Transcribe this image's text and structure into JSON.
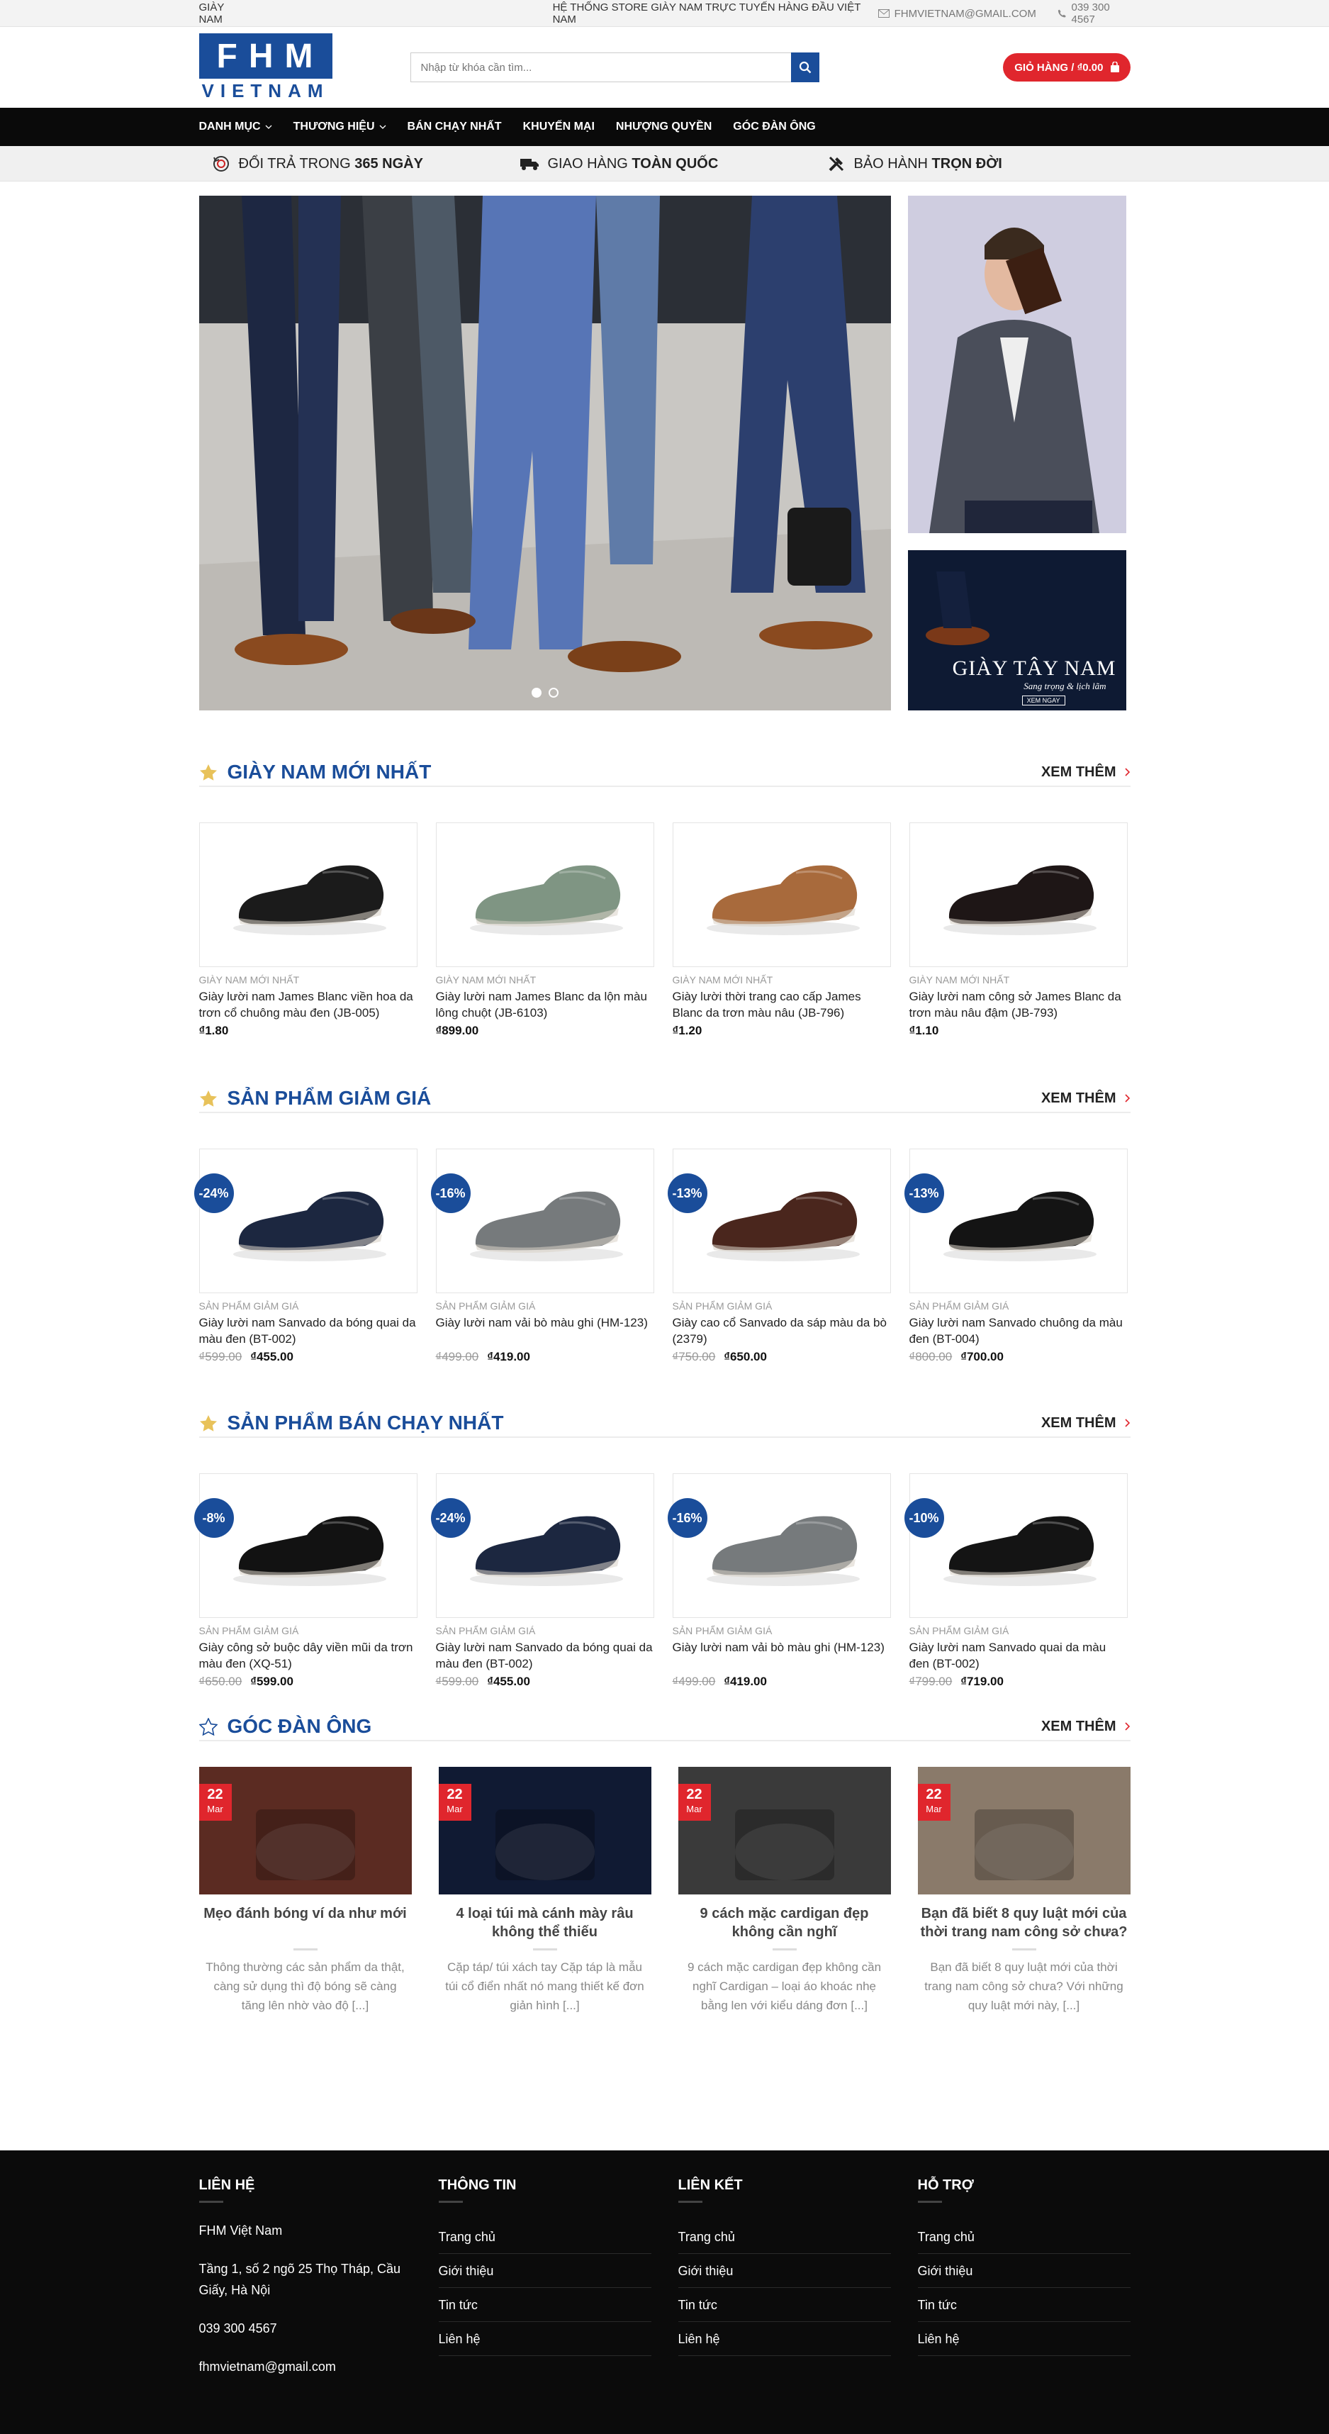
{
  "topbar": {
    "left": "GIÀY NAM",
    "slogan": "HỆ THỐNG STORE GIÀY NAM TRỰC TUYẾN HÀNG ĐẦU VIỆT NAM",
    "email": "FHMVIETNAM@GMAIL.COM",
    "phone": "039 300 4567"
  },
  "header": {
    "logo_letters": [
      "F",
      "H",
      "M"
    ],
    "logo_sub": "VIETNAM",
    "search_placeholder": "Nhập từ khóa cần tìm...",
    "cart": "GIỎ HÀNG / ₫0.00"
  },
  "nav": [
    "DANH MỤC",
    "THƯƠNG HIỆU",
    "BÁN CHẠY NHẤT",
    "KHUYẾN MẠI",
    "NHƯỢNG QUYỀN",
    "GÓC ĐÀN ÔNG"
  ],
  "benefits": [
    {
      "pre": "ĐỔI TRẢ TRONG ",
      "bold": "365 NGÀY"
    },
    {
      "pre": "GIAO HÀNG ",
      "bold": "TOÀN QUỐC"
    },
    {
      "pre": "BẢO HÀNH ",
      "bold": "TRỌN ĐỜI"
    }
  ],
  "banner": {
    "side_title": "GIÀY TÂY NAM",
    "side_sub": "Sang trọng & lịch lãm",
    "side_btn": "XEM NGAY"
  },
  "sections": [
    {
      "title": "GIÀY NAM MỚI NHẤT",
      "more": "XEM THÊM",
      "items": [
        {
          "cat": "GIÀY NAM MỚI NHẤT",
          "name": "Giày lười nam James Blanc viền hoa da trơn cổ chuông màu đen (JB-005)",
          "old": "",
          "price": "₫1.80",
          "badge": "",
          "color": "#1b1b1b"
        },
        {
          "cat": "GIÀY NAM MỚI NHẤT",
          "name": "Giày lười nam James Blanc da lộn màu lông chuột (JB-6103)",
          "old": "",
          "price": "₫899.00",
          "badge": "",
          "color": "#7f9583"
        },
        {
          "cat": "GIÀY NAM MỚI NHẤT",
          "name": "Giày lười thời trang cao cấp James Blanc da trơn màu nâu (JB-796)",
          "old": "",
          "price": "₫1.20",
          "badge": "",
          "color": "#a86a3c"
        },
        {
          "cat": "GIÀY NAM MỚI NHẤT",
          "name": "Giày lười nam công sở James Blanc da trơn màu nâu đậm (JB-793)",
          "old": "",
          "price": "₫1.10",
          "badge": "",
          "color": "#1e1616"
        }
      ]
    },
    {
      "title": "SẢN PHẨM GIẢM GIÁ",
      "more": "XEM THÊM",
      "items": [
        {
          "cat": "SẢN PHẨM GIẢM GIÁ",
          "name": "Giày lười nam Sanvado da bóng quai da màu đen (BT-002)",
          "old": "₫599.00",
          "price": "₫455.00",
          "badge": "-24%",
          "color": "#1c2740"
        },
        {
          "cat": "SẢN PHẨM GIẢM GIÁ",
          "name": "Giày lười nam vải bò màu ghi (HM-123)",
          "old": "₫499.00",
          "price": "₫419.00",
          "badge": "-16%",
          "color": "#767a7c"
        },
        {
          "cat": "SẢN PHẨM GIẢM GIÁ",
          "name": "Giày cao cổ Sanvado da sáp màu da bò (2379)",
          "old": "₫750.00",
          "price": "₫650.00",
          "badge": "-13%",
          "color": "#4a261d"
        },
        {
          "cat": "SẢN PHẨM GIẢM GIÁ",
          "name": "Giày lười nam Sanvado chuông da màu đen (BT-004)",
          "old": "₫800.00",
          "price": "₫700.00",
          "badge": "-13%",
          "color": "#141414"
        }
      ]
    },
    {
      "title": "SẢN PHẨM BÁN CHẠY NHẤT",
      "more": "XEM THÊM",
      "items": [
        {
          "cat": "SẢN PHẨM GIẢM GIÁ",
          "name": "Giày công sở buộc dây viền mũi da trơn màu đen (XQ-51)",
          "old": "₫650.00",
          "price": "₫599.00",
          "badge": "-8%",
          "color": "#121212"
        },
        {
          "cat": "SẢN PHẨM GIẢM GIÁ",
          "name": "Giày lười nam Sanvado da bóng quai da màu đen (BT-002)",
          "old": "₫599.00",
          "price": "₫455.00",
          "badge": "-24%",
          "color": "#1c2740"
        },
        {
          "cat": "SẢN PHẨM GIẢM GIÁ",
          "name": "Giày lười nam vải bò màu ghi (HM-123)",
          "old": "₫499.00",
          "price": "₫419.00",
          "badge": "-16%",
          "color": "#767a7c"
        },
        {
          "cat": "SẢN PHẨM GIẢM GIÁ",
          "name": "Giày lười nam Sanvado quai da màu đen (BT-002)",
          "old": "₫799.00",
          "price": "₫719.00",
          "badge": "-10%",
          "color": "#141414"
        }
      ]
    }
  ],
  "blog": {
    "title": "GÓC ĐÀN ÔNG",
    "more": "XEM THÊM",
    "posts": [
      {
        "day": "22",
        "mon": "Mar",
        "title": "Mẹo đánh bóng ví da như mới",
        "excerpt": "Thông thường các sản phẩm da thật, càng sử dụng thì độ bóng sẽ càng tăng lên nhờ vào độ [...]",
        "bg": "#5b2b22"
      },
      {
        "day": "22",
        "mon": "Mar",
        "title": "4 loại túi mà cánh mày râu không thể thiếu",
        "excerpt": "Cặp táp/ túi xách tay Cặp táp là mẫu túi cổ điển nhất nó mang thiết kế đơn giản hình [...]",
        "bg": "#101a33"
      },
      {
        "day": "22",
        "mon": "Mar",
        "title": "9 cách mặc cardigan đẹp không cần nghĩ",
        "excerpt": "9 cách mặc cardigan đẹp không cần nghĩ Cardigan – loại áo khoác nhẹ bằng len với kiểu dáng đơn [...]",
        "bg": "#3a3a3a"
      },
      {
        "day": "22",
        "mon": "Mar",
        "title": "Bạn đã biết 8 quy luật mới của thời trang nam công sở chưa?",
        "excerpt": "Bạn đã biết 8 quy luật mới của thời trang nam công sở chưa? Với những quy luật mới này, [...]",
        "bg": "#8a7a6a"
      }
    ]
  },
  "footer": {
    "contact": {
      "title": "LIÊN HỆ",
      "lines": [
        "FHM Việt Nam",
        "Tầng 1, số 2 ngõ 25 Thọ Tháp, Cầu Giấy, Hà Nội",
        "039 300 4567",
        "fhmvietnam@gmail.com"
      ]
    },
    "cols": [
      {
        "title": "THÔNG TIN",
        "links": [
          "Trang chủ",
          "Giới thiệu",
          "Tin tức",
          "Liên hệ"
        ]
      },
      {
        "title": "LIÊN KẾT",
        "links": [
          "Trang chủ",
          "Giới thiệu",
          "Tin tức",
          "Liên hệ"
        ]
      },
      {
        "title": "HỖ TRỢ",
        "links": [
          "Trang chủ",
          "Giới thiệu",
          "Tin tức",
          "Liên hệ"
        ]
      }
    ]
  },
  "colors": {
    "brand": "#1a4d9a",
    "accent": "#e0262d",
    "star": "#e8c25a"
  }
}
